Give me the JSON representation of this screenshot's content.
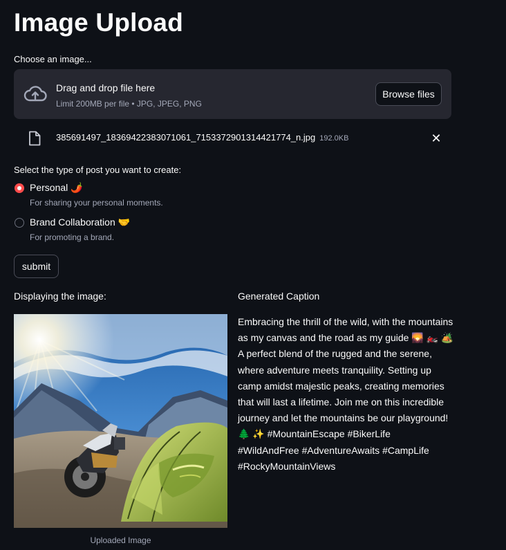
{
  "page": {
    "title": "Image Upload"
  },
  "uploader": {
    "label": "Choose an image...",
    "drop_text": "Drag and drop file here",
    "limit_text": "Limit 200MB per file • JPG, JPEG, PNG",
    "browse_label": "Browse files",
    "icon": "cloud-upload-icon"
  },
  "uploaded_file": {
    "name": "385691497_18369422383071061_7153372901314421774_n.jpg",
    "size": "192.0KB",
    "icon": "file-icon",
    "remove_icon": "close-icon",
    "remove_glyph": "✕"
  },
  "post_type": {
    "label": "Select the type of post you want to create:",
    "options": [
      {
        "label": "Personal 🌶️",
        "help": "For sharing your personal moments.",
        "selected": true
      },
      {
        "label": "Brand Collaboration 🤝",
        "help": "For promoting a brand.",
        "selected": false
      }
    ]
  },
  "submit": {
    "label": "submit"
  },
  "left_column": {
    "header": "Displaying the image:",
    "image_caption": "Uploaded Image"
  },
  "right_column": {
    "header": "Generated Caption",
    "caption": "Embracing the thrill of the wild, with the mountains as my canvas and the road as my guide 🌄 🏍️ 🏕️ A perfect blend of the rugged and the serene, where adventure meets tranquility. Setting up camp amidst majestic peaks, creating memories that will last a lifetime. Join me on this incredible journey and let the mountains be our playground! 🌲 ✨ #MountainEscape #BikerLife #WildAndFree #AdventureAwaits #CampLife #RockyMountainViews"
  },
  "colors": {
    "background": "#0e1117",
    "panel": "#262730",
    "accent": "#ff4b4b",
    "text": "#fafafa",
    "muted_text": "#a3a8b8"
  }
}
